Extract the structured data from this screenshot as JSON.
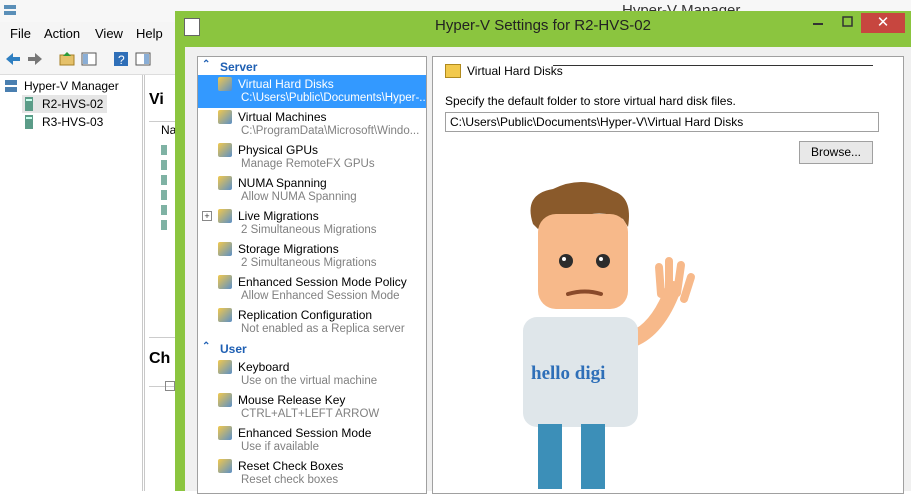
{
  "background_window": {
    "title": "Hyper-V Manager",
    "menu": [
      "File",
      "Action",
      "View",
      "Help"
    ],
    "tree": {
      "root": "Hyper-V Manager",
      "hosts": [
        "R2-HVS-02",
        "R3-HVS-03"
      ]
    },
    "partial_labels": {
      "vm_pane": "Vi",
      "name_col": "Na",
      "checkpoints": "Ch"
    }
  },
  "dialog": {
    "title": "Hyper-V Settings for R2-HVS-02",
    "close_label": "✕",
    "nav": {
      "server_label": "Server",
      "server_items": [
        {
          "label": "Virtual Hard Disks",
          "detail": "C:\\Users\\Public\\Documents\\Hyper-...",
          "icon": "hard-disk-folder-icon",
          "selected": true
        },
        {
          "label": "Virtual Machines",
          "detail": "C:\\ProgramData\\Microsoft\\Windo...",
          "icon": "vm-folder-icon"
        },
        {
          "label": "Physical GPUs",
          "detail": "Manage RemoteFX GPUs",
          "icon": "gpu-icon"
        },
        {
          "label": "NUMA Spanning",
          "detail": "Allow NUMA Spanning",
          "icon": "numa-icon"
        },
        {
          "label": "Live Migrations",
          "detail": "2 Simultaneous Migrations",
          "icon": "live-migration-icon",
          "expander": "+"
        },
        {
          "label": "Storage Migrations",
          "detail": "2 Simultaneous Migrations",
          "icon": "storage-migration-icon"
        },
        {
          "label": "Enhanced Session Mode Policy",
          "detail": "Allow Enhanced Session Mode",
          "icon": "session-policy-icon"
        },
        {
          "label": "Replication Configuration",
          "detail": "Not enabled as a Replica server",
          "icon": "replication-icon"
        }
      ],
      "user_label": "User",
      "user_items": [
        {
          "label": "Keyboard",
          "detail": "Use on the virtual machine",
          "icon": "keyboard-icon"
        },
        {
          "label": "Mouse Release Key",
          "detail": "CTRL+ALT+LEFT ARROW",
          "icon": "mouse-release-icon"
        },
        {
          "label": "Enhanced Session Mode",
          "detail": "Use if available",
          "icon": "session-mode-icon"
        },
        {
          "label": "Reset Check Boxes",
          "detail": "Reset check boxes",
          "icon": "reset-checkbox-icon"
        }
      ]
    },
    "content": {
      "heading": "Virtual Hard Disks",
      "description": "Specify the default folder to store virtual hard disk files.",
      "path_value": "C:\\Users\\Public\\Documents\\Hyper-V\\Virtual Hard Disks",
      "browse_label": "Browse...",
      "mascot_text": "hello digi"
    }
  },
  "colors": {
    "dialog_frame": "#8bc53f",
    "selection": "#3399ff",
    "section_header": "#1e5fb3",
    "close_button": "#c7463f"
  }
}
